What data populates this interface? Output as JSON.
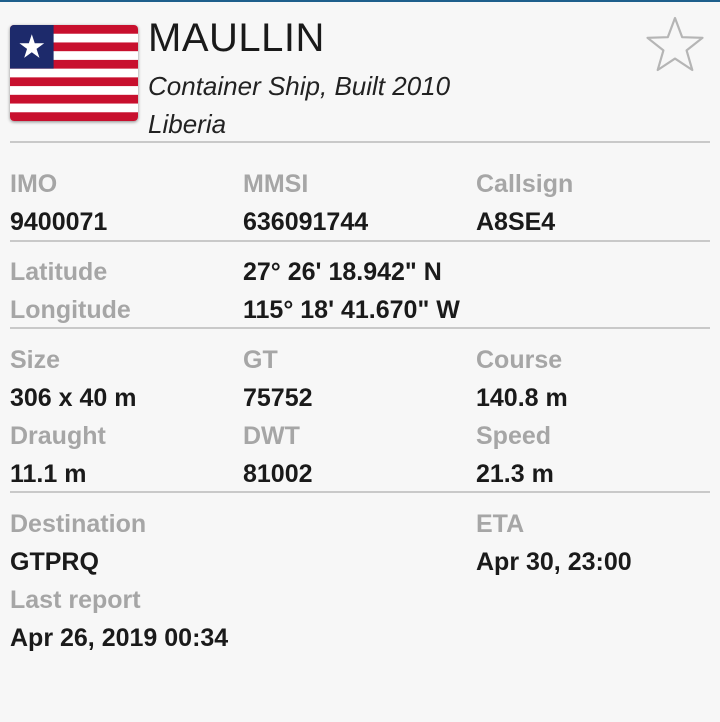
{
  "header": {
    "ship_name": "MAULLIN",
    "ship_type": "Container Ship, Built 2010",
    "country": "Liberia",
    "flag_icon": "liberia-flag-icon",
    "favorite_icon": "star-outline-icon"
  },
  "identifiers": {
    "imo_label": "IMO",
    "imo_value": "9400071",
    "mmsi_label": "MMSI",
    "mmsi_value": "636091744",
    "callsign_label": "Callsign",
    "callsign_value": "A8SE4"
  },
  "position": {
    "latitude_label": "Latitude",
    "latitude_value": "27° 26' 18.942\" N",
    "longitude_label": "Longitude",
    "longitude_value": "115° 18' 41.670\" W"
  },
  "dimensions": {
    "size_label": "Size",
    "size_value": "306 x 40 m",
    "gt_label": "GT",
    "gt_value": "75752",
    "course_label": "Course",
    "course_value": "140.8 m",
    "draught_label": "Draught",
    "draught_value": "11.1 m",
    "dwt_label": "DWT",
    "dwt_value": "81002",
    "speed_label": "Speed",
    "speed_value": "21.3 m"
  },
  "voyage": {
    "destination_label": "Destination",
    "destination_value": "GTPRQ",
    "eta_label": "ETA",
    "eta_value": "Apr 30, 23:00",
    "last_report_label": "Last report",
    "last_report_value": "Apr 26, 2019 00:34"
  },
  "colors": {
    "accent_line": "#1e5f8c",
    "label_gray": "#a6a6a6",
    "divider": "#c9c9c9",
    "flag_red": "#c8102e",
    "flag_blue": "#1d2a6b"
  }
}
